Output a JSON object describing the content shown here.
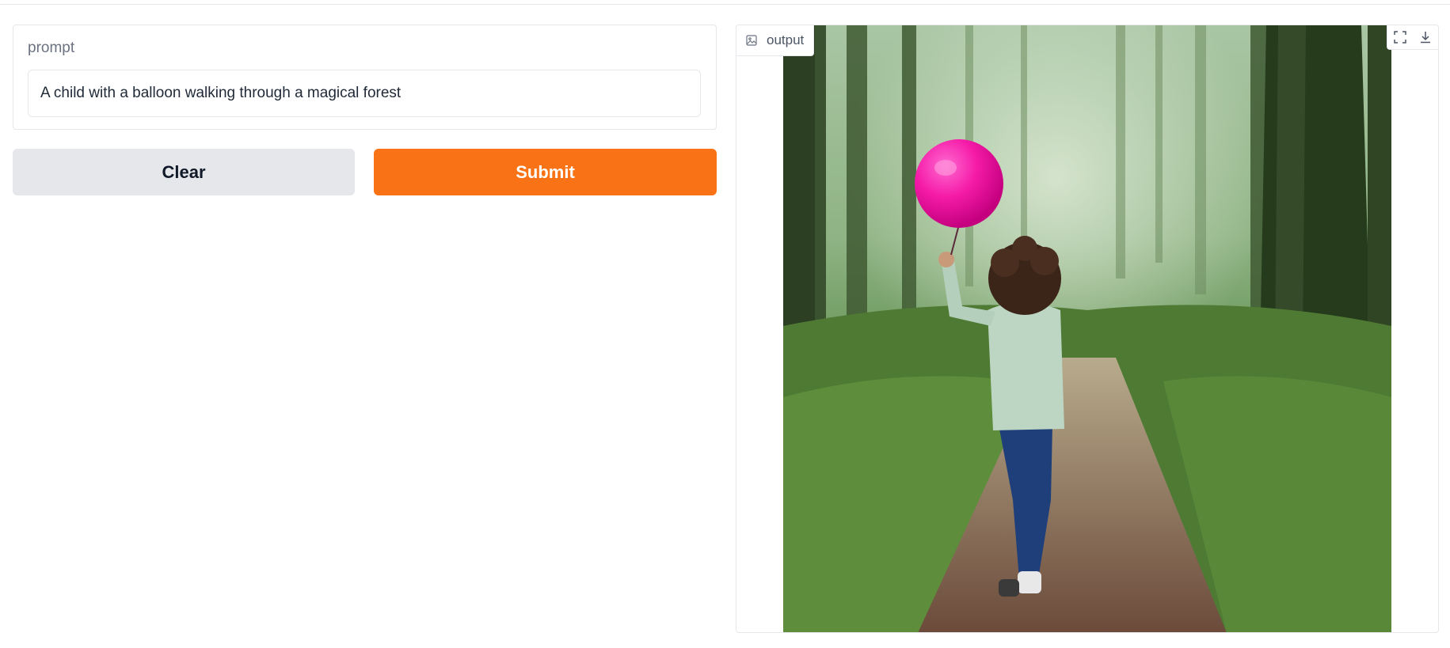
{
  "inputs": {
    "prompt_label": "prompt",
    "prompt_value": "A child with a balloon walking through a magical forest"
  },
  "actions": {
    "clear_label": "Clear",
    "submit_label": "Submit"
  },
  "output": {
    "label": "output",
    "image_description_icon": "image-icon",
    "tools": [
      "fullscreen-icon",
      "download-icon"
    ]
  },
  "colors": {
    "accent": "#f97316",
    "secondary_button": "#e5e7eb",
    "border": "#e5e7eb",
    "label_text": "#6b7280"
  }
}
